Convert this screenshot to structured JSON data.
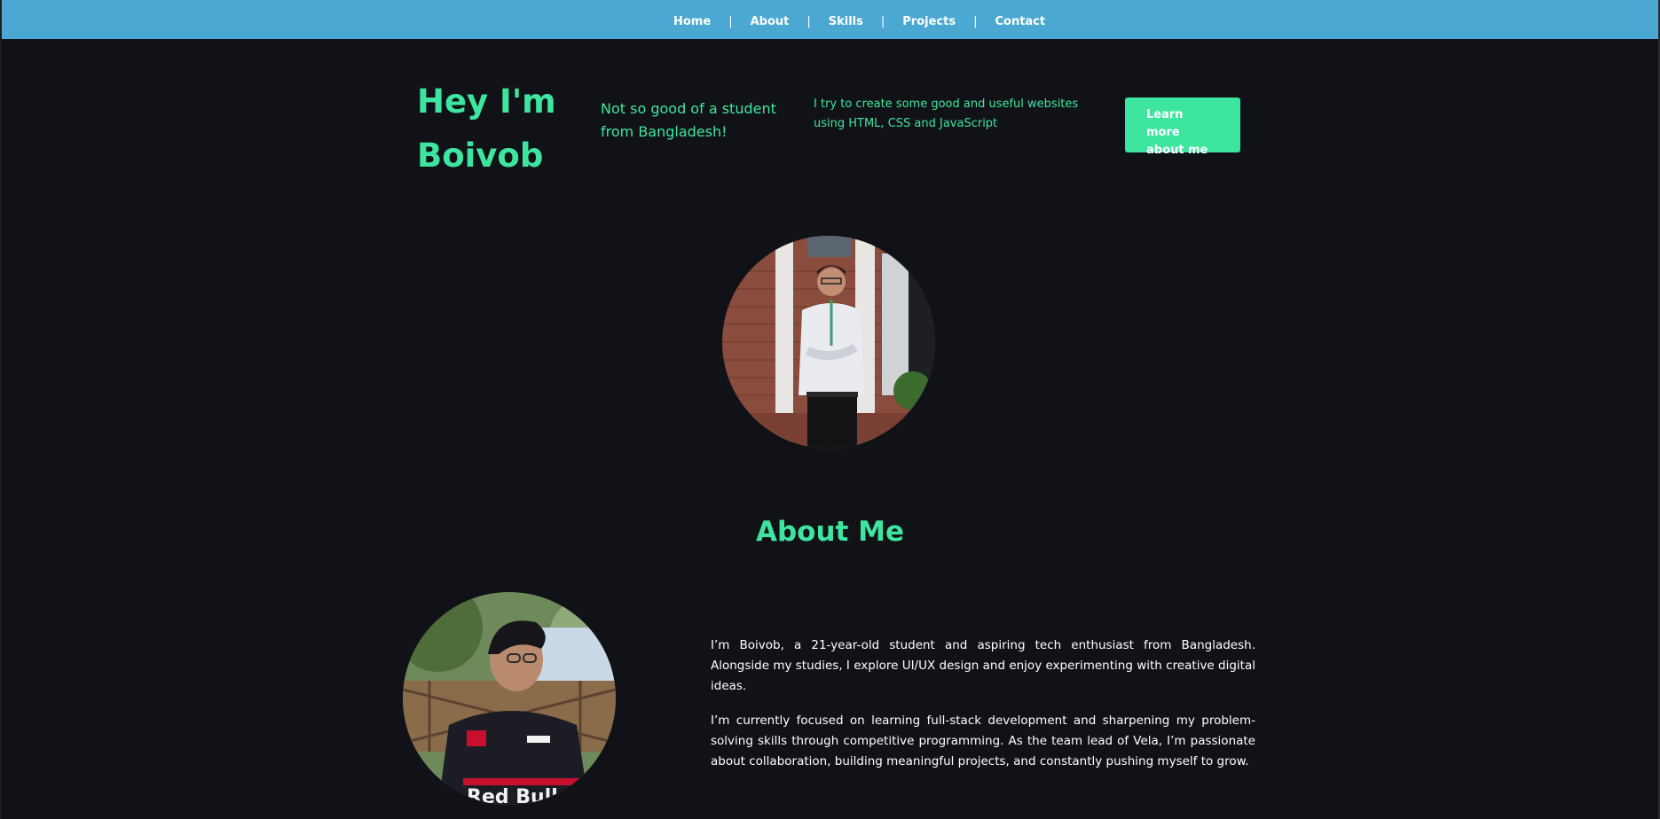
{
  "nav": {
    "items": [
      {
        "label": "Home"
      },
      {
        "label": "About"
      },
      {
        "label": "Skills"
      },
      {
        "label": "Projects"
      },
      {
        "label": "Contact"
      }
    ],
    "separator": "|"
  },
  "hero": {
    "title_line1": "Hey I'm",
    "title_line2": "Boivob",
    "tagline": "Not so good of a student from Bangladesh!",
    "description": "I try to create some good and useful websites using HTML, CSS and JavaScript",
    "cta_label": "Learn more about me"
  },
  "about": {
    "heading": "About Me",
    "paragraphs": [
      "I’m Boivob, a 21-year-old student and aspiring tech enthusiast from Bangladesh. Alongside my studies, I explore UI/UX design and enjoy experimenting with creative digital ideas.",
      "I’m currently focused on learning full-stack development and sharpening my problem-solving skills through competitive programming. As the team lead of Vela, I’m passionate about collaboration, building meaningful projects, and constantly pushing myself to grow."
    ],
    "jersey_text": "Red Bull"
  },
  "colors": {
    "nav_bg": "#4aa8d2",
    "page_bg": "#111217",
    "accent": "#3ee59f",
    "text": "#ffffff"
  }
}
